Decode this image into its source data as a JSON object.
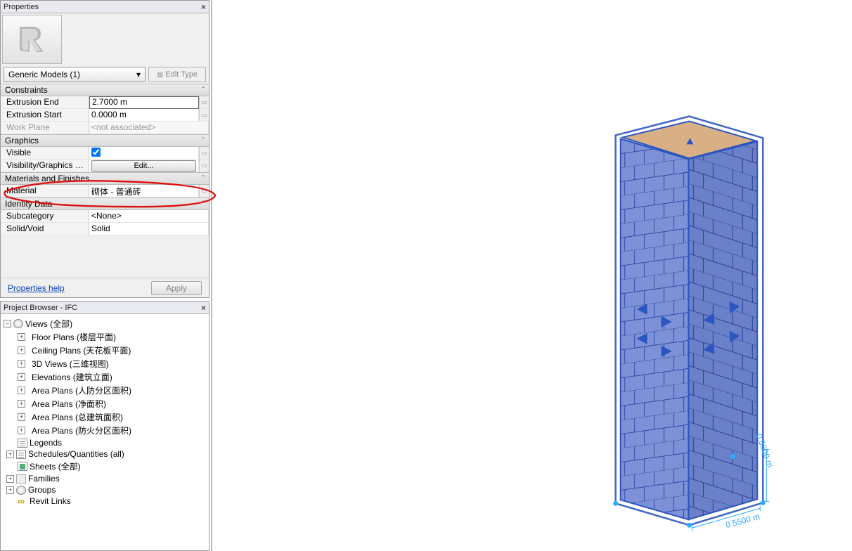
{
  "properties": {
    "panel_title": "Properties",
    "type_selector": "Generic Models (1)",
    "edit_type_label": "Edit Type",
    "sections": {
      "constraints": {
        "label": "Constraints",
        "rows": [
          {
            "label": "Extrusion End",
            "value": "2.7000 m",
            "boxed": true,
            "btn": true
          },
          {
            "label": "Extrusion Start",
            "value": "0.0000 m",
            "boxed": false,
            "btn": true
          },
          {
            "label": "Work Plane",
            "value": "<not associated>",
            "disabled": true
          }
        ]
      },
      "graphics": {
        "label": "Graphics",
        "rows": [
          {
            "label": "Visible",
            "checkbox": true,
            "btn": true
          },
          {
            "label": "Visibility/Graphics O...",
            "edit_button": "Edit...",
            "btn": true
          }
        ]
      },
      "materials": {
        "label": "Materials and Finishes",
        "rows": [
          {
            "label": "Material",
            "value": "砌体 - 普通砖",
            "btn": true
          }
        ]
      },
      "identity": {
        "label": "Identity Data",
        "rows": [
          {
            "label": "Subcategory",
            "value": "<None>"
          },
          {
            "label": "Solid/Void",
            "value": "Solid"
          }
        ]
      }
    },
    "help_link": "Properties help",
    "apply_label": "Apply"
  },
  "browser": {
    "panel_title": "Project Browser - IFC",
    "root": {
      "exp": "−",
      "icon": "circle",
      "label": "Views (全部)"
    },
    "views": [
      "Floor Plans (楼层平面)",
      "Ceiling Plans (天花板平面)",
      "3D Views (三维视图)",
      "Elevations (建筑立面)",
      "Area Plans (人防分区面积)",
      "Area Plans (净面积)",
      "Area Plans (总建筑面积)",
      "Area Plans (防火分区面积)"
    ],
    "other": [
      {
        "exp": "",
        "icon": "sheet1",
        "label": "Legends"
      },
      {
        "exp": "+",
        "icon": "sheet1",
        "label": "Schedules/Quantities (all)"
      },
      {
        "exp": "",
        "icon": "sheet2",
        "label": "Sheets (全部)"
      },
      {
        "exp": "+",
        "icon": "folder",
        "label": "Families"
      },
      {
        "exp": "+",
        "icon": "circle",
        "label": "Groups"
      },
      {
        "exp": "",
        "icon": "link",
        "label": "Revit Links"
      }
    ]
  },
  "viewport": {
    "dim_x": "0.5500 m",
    "dim_y": "0.5500 m"
  }
}
